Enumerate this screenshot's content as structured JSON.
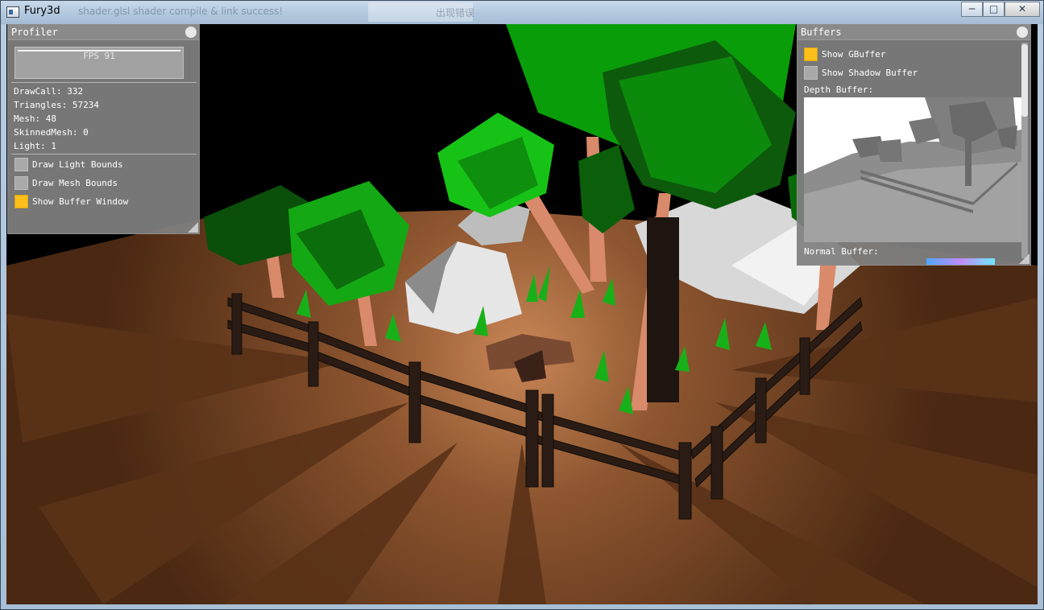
{
  "window": {
    "title": "Fury3d",
    "ghost_text_left": "shader.glsl shader compile & link success!",
    "ghost_text_right": "出现错误",
    "minimize": "─",
    "maximize": "□",
    "close": "✕"
  },
  "profiler": {
    "title": "Profiler",
    "fps": "FPS 91",
    "stats": {
      "draw_call": "DrawCall: 332",
      "triangles": "Triangles: 57234",
      "mesh": "Mesh: 48",
      "skinned_mesh": "SkinnedMesh: 0",
      "light": "Light: 1"
    },
    "options": [
      {
        "label": "Draw Light Bounds",
        "checked": false
      },
      {
        "label": "Draw Mesh Bounds",
        "checked": false
      },
      {
        "label": "Show Buffer Window",
        "checked": true
      }
    ]
  },
  "buffers": {
    "title": "Buffers",
    "options": [
      {
        "label": "Show GBuffer",
        "checked": true
      },
      {
        "label": "Show Shadow Buffer",
        "checked": false
      }
    ],
    "depth_label": "Depth Buffer:",
    "normal_label": "Normal Buffer:"
  },
  "colors": {
    "checkbox_on": "#ffbf1a",
    "panel_bg": "#808080",
    "ground": "#7a4a26",
    "foliage": "#17c217"
  }
}
